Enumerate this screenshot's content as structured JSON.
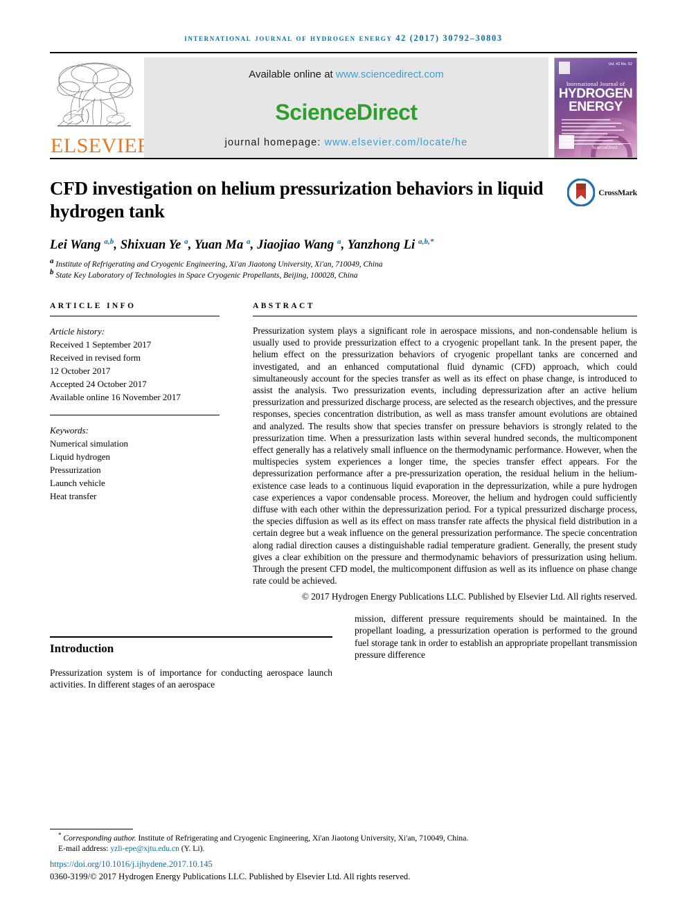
{
  "running_head": "international journal of hydrogen energy 42 (2017) 30792–30803",
  "masthead": {
    "publisher_name": "ELSEVIER",
    "available_prefix": "Available online at ",
    "sciencedirect_url": "www.sciencedirect.com",
    "sciencedirect_wordmark": "ScienceDirect",
    "homepage_prefix": "journal homepage: ",
    "homepage_url": "www.elsevier.com/locate/he",
    "cover": {
      "line1": "International Journal of",
      "line2": "HYDROGEN",
      "line3": "ENERGY",
      "top_right": "Vol. 42 No. 52",
      "footer_text": "ScienceDirect"
    }
  },
  "article": {
    "title": "CFD investigation on helium pressurization behaviors in liquid hydrogen tank",
    "crossmark_label": "CrossMark",
    "authors_html": "Lei Wang <sup>a,b</sup>, Shixuan Ye <sup>a</sup>, Yuan Ma <sup>a</sup>, Jiaojiao Wang <sup>a</sup>, Yanzhong Li <sup>a,b,*</sup>",
    "affiliations": [
      {
        "marker": "a",
        "text": "Institute of Refrigerating and Cryogenic Engineering, Xi'an Jiaotong University, Xi'an, 710049, China"
      },
      {
        "marker": "b",
        "text": "State Key Laboratory of Technologies in Space Cryogenic Propellants, Beijing, 100028, China"
      }
    ]
  },
  "article_info": {
    "label": "ARTICLE INFO",
    "history_title": "Article history:",
    "history": [
      "Received 1 September 2017",
      "Received in revised form",
      "12 October 2017",
      "Accepted 24 October 2017",
      "Available online 16 November 2017"
    ],
    "keywords_title": "Keywords:",
    "keywords": [
      "Numerical simulation",
      "Liquid hydrogen",
      "Pressurization",
      "Launch vehicle",
      "Heat transfer"
    ]
  },
  "abstract": {
    "label": "ABSTRACT",
    "text": "Pressurization system plays a significant role in aerospace missions, and non-condensable helium is usually used to provide pressurization effect to a cryogenic propellant tank. In the present paper, the helium effect on the pressurization behaviors of cryogenic propellant tanks are concerned and investigated, and an enhanced computational fluid dynamic (CFD) approach, which could simultaneously account for the species transfer as well as its effect on phase change, is introduced to assist the analysis. Two pressurization events, including depressurization after an active helium pressurization and pressurized discharge process, are selected as the research objectives, and the pressure responses, species concentration distribution, as well as mass transfer amount evolutions are obtained and analyzed. The results show that species transfer on pressure behaviors is strongly related to the pressurization time. When a pressurization lasts within several hundred seconds, the multicomponent effect generally has a relatively small influence on the thermodynamic performance. However, when the multispecies system experiences a longer time, the species transfer effect appears. For the depressurization performance after a pre-pressurization operation, the residual helium in the helium-existence case leads to a continuous liquid evaporation in the depressurization, while a pure hydrogen case experiences a vapor condensable process. Moreover, the helium and hydrogen could sufficiently diffuse with each other within the depressurization period. For a typical pressurized discharge process, the species diffusion as well as its effect on mass transfer rate affects the physical field distribution in a certain degree but a weak influence on the general pressurization performance. The specie concentration along radial direction causes a distinguishable radial temperature gradient. Generally, the present study gives a clear exhibition on the pressure and thermodynamic behaviors of pressurization using helium. Through the present CFD model, the multicomponent diffusion as well as its influence on phase change rate could be achieved.",
    "copyright": "© 2017 Hydrogen Energy Publications LLC. Published by Elsevier Ltd. All rights reserved."
  },
  "body": {
    "section_heading": "Introduction",
    "left_paragraph": "Pressurization system is of importance for conducting aerospace launch activities. In different stages of an aerospace",
    "right_paragraph": "mission, different pressure requirements should be maintained. In the propellant loading, a pressurization operation is performed to the ground fuel storage tank in order to establish an appropriate propellant transmission pressure difference"
  },
  "footnotes": {
    "corresponding_marker": "*",
    "corresponding_label": "Corresponding author.",
    "corresponding_text": " Institute of Refrigerating and Cryogenic Engineering, Xi'an Jiaotong University, Xi'an, 710049, China.",
    "email_label": "E-mail address: ",
    "email": "yzli-epe@xjtu.edu.cn",
    "email_suffix": " (Y. Li).",
    "doi": "https://doi.org/10.1016/j.ijhydene.2017.10.145",
    "issn_line": "0360-3199/© 2017 Hydrogen Energy Publications LLC. Published by Elsevier Ltd. All rights reserved."
  },
  "colors": {
    "link_blue": "#0b6ea8",
    "sciencedirect_green": "#2f9e2f",
    "elsevier_orange": "#e87722",
    "sd_link_blue": "#3c9fd4"
  }
}
